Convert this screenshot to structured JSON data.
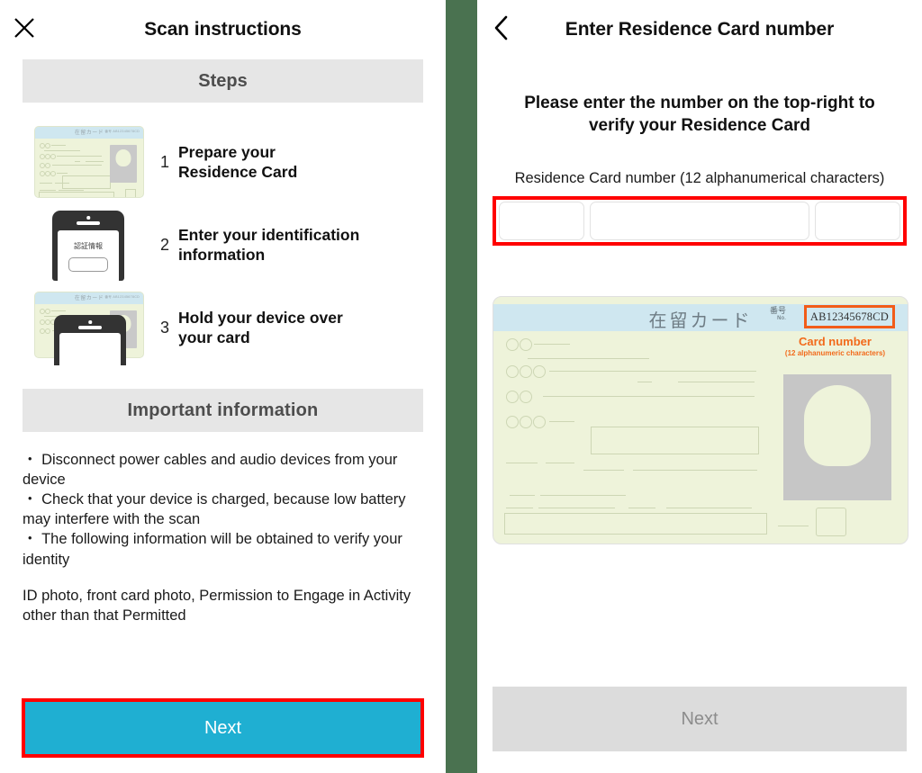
{
  "left": {
    "nav": {
      "close_icon": "close-icon",
      "title": "Scan instructions"
    },
    "steps_band": "Steps",
    "steps": [
      {
        "num": "1",
        "label": "Prepare your\nResidence Card",
        "art": "residence-card"
      },
      {
        "num": "2",
        "label": "Enter your identification\ninformation",
        "art": "phone"
      },
      {
        "num": "3",
        "label": "Hold your device over\nyour card",
        "art": "phone-over-card"
      }
    ],
    "info_band": "Important  information",
    "info_lines": [
      "・ Disconnect power cables and audio devices from your device",
      "・ Check that your device is charged, because low battery may interfere with the scan",
      "・ The following information will be obtained to verify your identity"
    ],
    "info_extra": "ID photo, front card photo, Permission to Engage in Activity other than that Permitted",
    "next_label": "Next"
  },
  "right": {
    "nav": {
      "back_icon": "chevron-left-icon",
      "title": "Enter Residence Card number"
    },
    "subtitle": "Please enter the number on the top-right to verify your Residence Card",
    "field_label": "Residence Card number (12 alphanumerical characters)",
    "input_segments": [
      {
        "value": "",
        "placeholder": ""
      },
      {
        "value": "",
        "placeholder": ""
      },
      {
        "value": "",
        "placeholder": ""
      }
    ],
    "card": {
      "title": "在留カード",
      "no_label": "番号",
      "no_sub": "No.",
      "number": "AB12345678CD",
      "annotation": "Card number",
      "annotation_sub": "(12 alphanumeric characters)"
    },
    "next_label": "Next"
  },
  "phone_art": {
    "screen_text": "認証情報"
  },
  "card_thumb": {
    "title": "在留カード",
    "no": "番号 AB12345678CD"
  },
  "colors": {
    "primary": "#1fafd2",
    "highlight": "#ff0000",
    "divider": "#4a7250",
    "band": "#e6e6e6",
    "disabled": "#dcdcdc",
    "card_body": "#eef3da",
    "card_header": "#cfe7f0",
    "annotation": "#f26a1b"
  }
}
